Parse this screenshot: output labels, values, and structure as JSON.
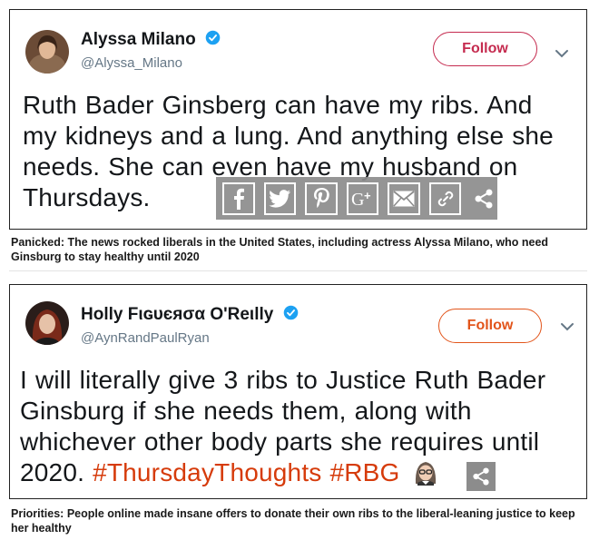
{
  "tweets": [
    {
      "name": "Alyssa Milano",
      "handle": "@Alyssa_Milano",
      "follow_label": "Follow",
      "text_lines": [
        "Ruth Bader Ginsberg can have my ribs. And",
        "my kidneys and a lung. And anything else she",
        "needs. She can even have my husband on",
        "Thursdays."
      ],
      "caption": "Panicked: The news rocked liberals in the United States, including actress Alyssa Milano, who need Ginsburg to stay healthy until 2020"
    },
    {
      "name": "Holly Fιɢυєяσα O'Reιlly",
      "handle": "@AynRandPaulRyan",
      "follow_label": "Follow",
      "text_lines": [
        "I will literally give 3 ribs to Justice Ruth Bader",
        "Ginsburg if she needs them, along with",
        "whichever other body parts she requires until"
      ],
      "last_line_prefix": "2020.",
      "hashtags": [
        "#ThursdayThoughts",
        "#RBG"
      ],
      "caption": "Priorities: People online made insane offers to donate their own ribs to the liberal-leaning justice to keep her healthy"
    }
  ],
  "share_bar": {
    "icons": [
      "facebook-icon",
      "twitter-icon",
      "pinterest-icon",
      "google-plus-icon",
      "email-icon",
      "link-icon",
      "share-icon"
    ]
  },
  "colors": {
    "verified": "#1da1f2",
    "follow_card1": "#c52b4f",
    "follow_card2": "#e2551b",
    "hashtag": "#d63b0b",
    "share_bar_bg": "#8c8c8c"
  }
}
